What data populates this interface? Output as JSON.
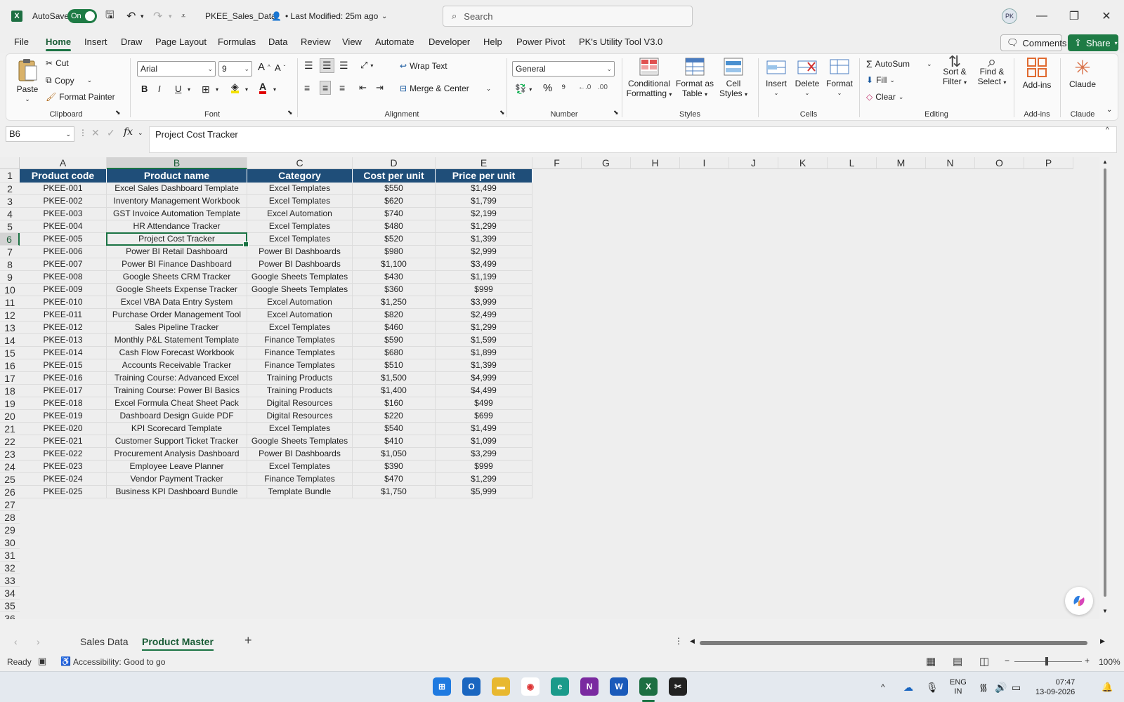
{
  "titlebar": {
    "autosave_label": "AutoSave",
    "autosave_state": "On",
    "file_name": "PKEE_Sales_Data",
    "modified": "• Last Modified: 25m ago",
    "search_placeholder": "Search"
  },
  "menu": {
    "tabs": [
      "File",
      "Home",
      "Insert",
      "Draw",
      "Page Layout",
      "Formulas",
      "Data",
      "Review",
      "View",
      "Automate",
      "Developer",
      "Help",
      "Power Pivot",
      "PK's Utility Tool V3.0"
    ],
    "active": "Home",
    "comments": "Comments",
    "share": "Share"
  },
  "ribbon": {
    "clipboard": {
      "label": "Clipboard",
      "paste": "Paste",
      "cut": "Cut",
      "copy": "Copy",
      "format_painter": "Format Painter"
    },
    "font": {
      "label": "Font",
      "family": "Arial",
      "size": "9"
    },
    "alignment": {
      "label": "Alignment",
      "wrap_text": "Wrap Text",
      "merge_center": "Merge & Center"
    },
    "number": {
      "label": "Number",
      "format": "General"
    },
    "styles": {
      "label": "Styles",
      "conditional": "Conditional",
      "conditional2": "Formatting",
      "format_as": "Format as",
      "format_as2": "Table",
      "cell": "Cell",
      "cell2": "Styles"
    },
    "cells": {
      "label": "Cells",
      "insert": "Insert",
      "delete": "Delete",
      "format": "Format"
    },
    "editing": {
      "label": "Editing",
      "autosum": "AutoSum",
      "fill": "Fill",
      "clear": "Clear",
      "sort": "Sort &",
      "sort2": "Filter",
      "find": "Find &",
      "find2": "Select"
    },
    "addins": {
      "label": "Add-ins",
      "button": "Add-ins"
    },
    "claude": {
      "label": "Claude",
      "button": "Claude"
    }
  },
  "formula": {
    "name_box": "B6",
    "content": "Project Cost Tracker"
  },
  "columns": [
    "A",
    "B",
    "C",
    "D",
    "E",
    "F",
    "G",
    "H",
    "I",
    "J",
    "K",
    "L",
    "M",
    "N",
    "O",
    "P"
  ],
  "headers": [
    "Product code",
    "Product name",
    "Category",
    "Cost per unit",
    "Price per unit"
  ],
  "rows": [
    [
      "PKEE-001",
      "Excel Sales Dashboard Template",
      "Excel Templates",
      "$550",
      "$1,499"
    ],
    [
      "PKEE-002",
      "Inventory Management Workbook",
      "Excel Templates",
      "$620",
      "$1,799"
    ],
    [
      "PKEE-003",
      "GST Invoice Automation Template",
      "Excel Automation",
      "$740",
      "$2,199"
    ],
    [
      "PKEE-004",
      "HR Attendance Tracker",
      "Excel Templates",
      "$480",
      "$1,299"
    ],
    [
      "PKEE-005",
      "Project Cost Tracker",
      "Excel Templates",
      "$520",
      "$1,399"
    ],
    [
      "PKEE-006",
      "Power BI Retail Dashboard",
      "Power BI Dashboards",
      "$980",
      "$2,999"
    ],
    [
      "PKEE-007",
      "Power BI Finance Dashboard",
      "Power BI Dashboards",
      "$1,100",
      "$3,499"
    ],
    [
      "PKEE-008",
      "Google Sheets CRM Tracker",
      "Google Sheets Templates",
      "$430",
      "$1,199"
    ],
    [
      "PKEE-009",
      "Google Sheets Expense Tracker",
      "Google Sheets Templates",
      "$360",
      "$999"
    ],
    [
      "PKEE-010",
      "Excel VBA Data Entry System",
      "Excel Automation",
      "$1,250",
      "$3,999"
    ],
    [
      "PKEE-011",
      "Purchase Order Management Tool",
      "Excel Automation",
      "$820",
      "$2,499"
    ],
    [
      "PKEE-012",
      "Sales Pipeline Tracker",
      "Excel Templates",
      "$460",
      "$1,299"
    ],
    [
      "PKEE-013",
      "Monthly P&L Statement Template",
      "Finance Templates",
      "$590",
      "$1,599"
    ],
    [
      "PKEE-014",
      "Cash Flow Forecast Workbook",
      "Finance Templates",
      "$680",
      "$1,899"
    ],
    [
      "PKEE-015",
      "Accounts Receivable Tracker",
      "Finance Templates",
      "$510",
      "$1,399"
    ],
    [
      "PKEE-016",
      "Training Course: Advanced Excel",
      "Training Products",
      "$1,500",
      "$4,999"
    ],
    [
      "PKEE-017",
      "Training Course: Power BI Basics",
      "Training Products",
      "$1,400",
      "$4,499"
    ],
    [
      "PKEE-018",
      "Excel Formula Cheat Sheet Pack",
      "Digital Resources",
      "$160",
      "$499"
    ],
    [
      "PKEE-019",
      "Dashboard Design Guide PDF",
      "Digital Resources",
      "$220",
      "$699"
    ],
    [
      "PKEE-020",
      "KPI Scorecard Template",
      "Excel Templates",
      "$540",
      "$1,499"
    ],
    [
      "PKEE-021",
      "Customer Support Ticket Tracker",
      "Google Sheets Templates",
      "$410",
      "$1,099"
    ],
    [
      "PKEE-022",
      "Procurement Analysis Dashboard",
      "Power BI Dashboards",
      "$1,050",
      "$3,299"
    ],
    [
      "PKEE-023",
      "Employee Leave Planner",
      "Excel Templates",
      "$390",
      "$999"
    ],
    [
      "PKEE-024",
      "Vendor Payment Tracker",
      "Finance Templates",
      "$470",
      "$1,299"
    ],
    [
      "PKEE-025",
      "Business KPI Dashboard Bundle",
      "Template Bundle",
      "$1,750",
      "$5,999"
    ]
  ],
  "row_numbers": [
    "1",
    "2",
    "3",
    "4",
    "5",
    "6",
    "7",
    "8",
    "9",
    "10",
    "11",
    "12",
    "13",
    "14",
    "15",
    "16",
    "17",
    "18",
    "19",
    "20",
    "21",
    "22",
    "23",
    "24",
    "25",
    "26",
    "27",
    "28",
    "29",
    "30",
    "31",
    "32",
    "33",
    "34",
    "35",
    "36"
  ],
  "sheets": [
    "Sales Data",
    "Product Master"
  ],
  "active_sheet": "Product Master",
  "status": {
    "ready": "Ready",
    "accessibility": "Accessibility: Good to go",
    "zoom": "100%"
  },
  "taskbar": {
    "lang1": "ENG",
    "lang2": "IN",
    "time": "07:47",
    "date": "13-09-2026"
  },
  "colors": {
    "header_fill": "#1f4e79",
    "accent": "#1a7343"
  }
}
